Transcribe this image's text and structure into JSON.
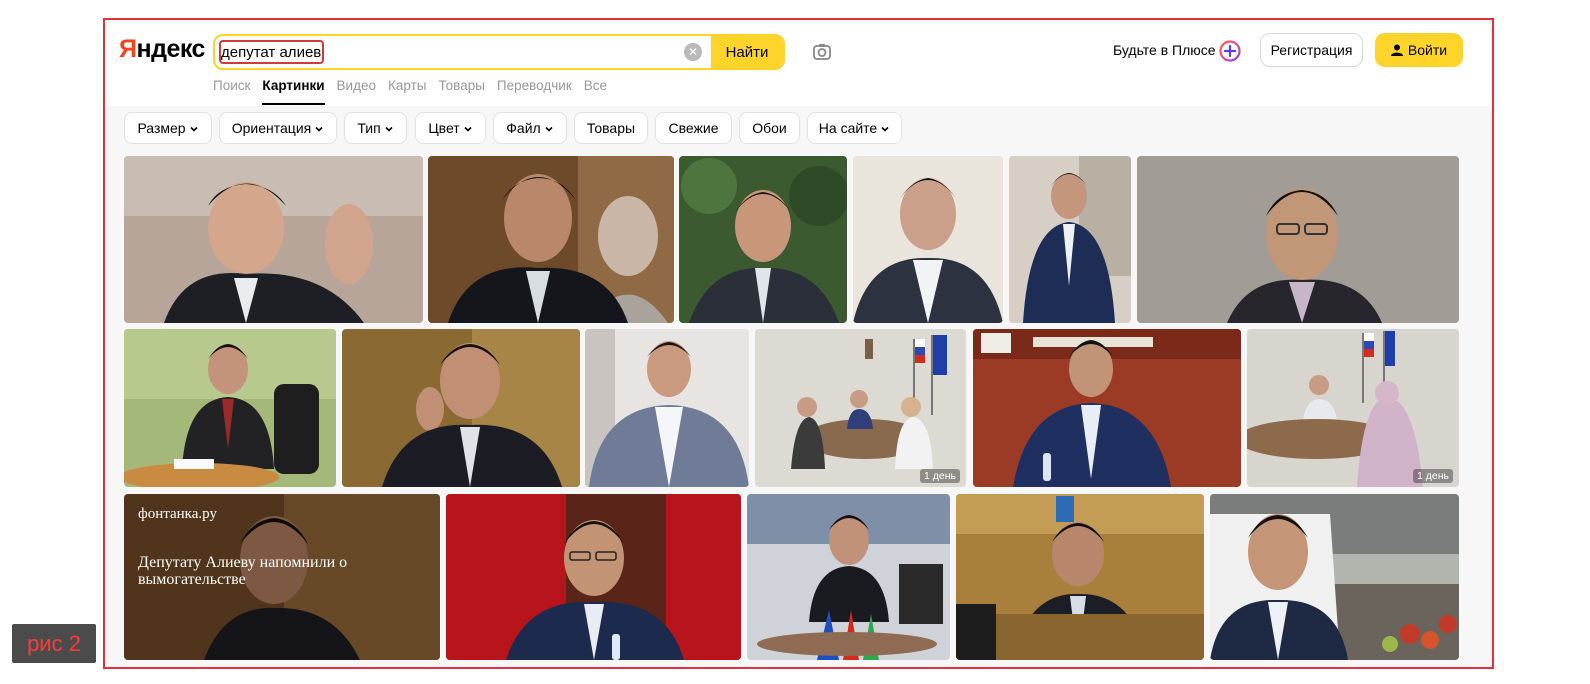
{
  "header": {
    "logo": "Яндекс",
    "search": {
      "value": "депутат алиев",
      "placeholder": ""
    },
    "find_label": "Найти",
    "plus_label": "Будьте в Плюсе",
    "register_label": "Регистрация",
    "login_label": "Войти"
  },
  "tabs": [
    {
      "label": "Поиск",
      "active": false
    },
    {
      "label": "Картинки",
      "active": true
    },
    {
      "label": "Видео",
      "active": false
    },
    {
      "label": "Карты",
      "active": false
    },
    {
      "label": "Товары",
      "active": false
    },
    {
      "label": "Переводчик",
      "active": false
    },
    {
      "label": "Все",
      "active": false
    }
  ],
  "filters": [
    {
      "label": "Размер",
      "dropdown": true
    },
    {
      "label": "Ориентация",
      "dropdown": true
    },
    {
      "label": "Тип",
      "dropdown": true
    },
    {
      "label": "Цвет",
      "dropdown": true
    },
    {
      "label": "Файл",
      "dropdown": true
    },
    {
      "label": "Товары",
      "dropdown": false
    },
    {
      "label": "Свежие",
      "dropdown": false
    },
    {
      "label": "Обои",
      "dropdown": false
    },
    {
      "label": "На сайте",
      "dropdown": true
    }
  ],
  "results": {
    "badge_1": "1 день",
    "badge_2": "1 день",
    "fontanka_logo": "фонтанка.ру",
    "fontanka_headline": "Депутату Алиеву напомнили о вымогательстве"
  },
  "figure_label": "рис 2",
  "colors": {
    "accent": "#fed42b",
    "logo_red": "#fc3f1d",
    "frame_border": "#e0323a"
  }
}
